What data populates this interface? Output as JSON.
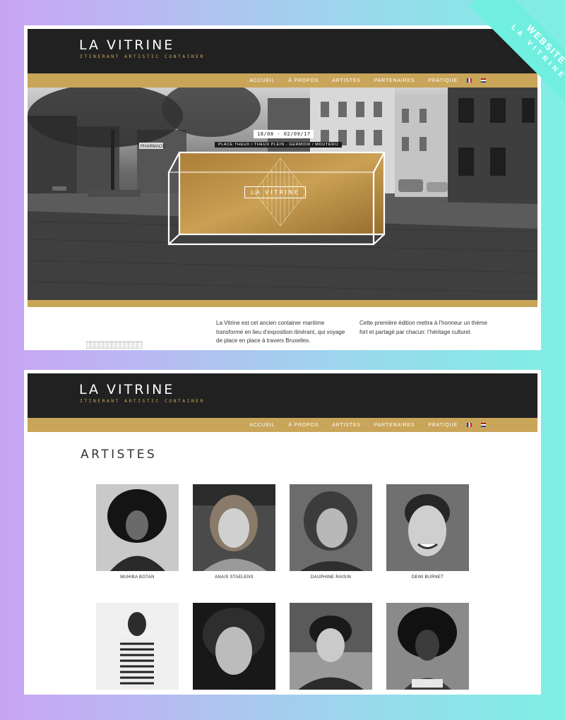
{
  "site": {
    "title": "LA VITRINE",
    "subtitle": "ITINERANT ARTISTIC CONTAINER"
  },
  "nav": {
    "items": [
      "ACCUEIL",
      "À PROPOS",
      "ARTISTES",
      "PARTENAIRES",
      "PRATIQUE"
    ],
    "flags": [
      "fr-flag-icon",
      "nl-flag-icon"
    ]
  },
  "hero": {
    "dates": "18/08 - 02/09/17",
    "place": "PLACE THEUX / THEUX PLEIN - GERMOIR / MOUTERIJ",
    "logo": "LA VITRINE",
    "storefront": "PHARMACIE"
  },
  "intro": {
    "left": "La Vitrine est cet  ancien container maritime transformé en lieu d’exposition itinérant, qui voyage de place en place à travers Bruxelles.",
    "right": "Cette première édition mettra à l’honneur un thème fort et partagé par chacun: l’héritage culturel."
  },
  "artists_page": {
    "title": "ARTISTES",
    "artists": [
      {
        "name": "MUHIBA BOTAN"
      },
      {
        "name": "ANAIS STAELENS"
      },
      {
        "name": "DAUPHINE RAISIN"
      },
      {
        "name": "DEWI BURNET"
      }
    ],
    "unlabeled_photo_count": 4
  },
  "ribbon": {
    "main": "WEBSITE",
    "sub": "LA VITRINE"
  },
  "colors": {
    "header": "#212121",
    "accent_gold": "#c9a55a",
    "ribbon": "#70efe0"
  }
}
